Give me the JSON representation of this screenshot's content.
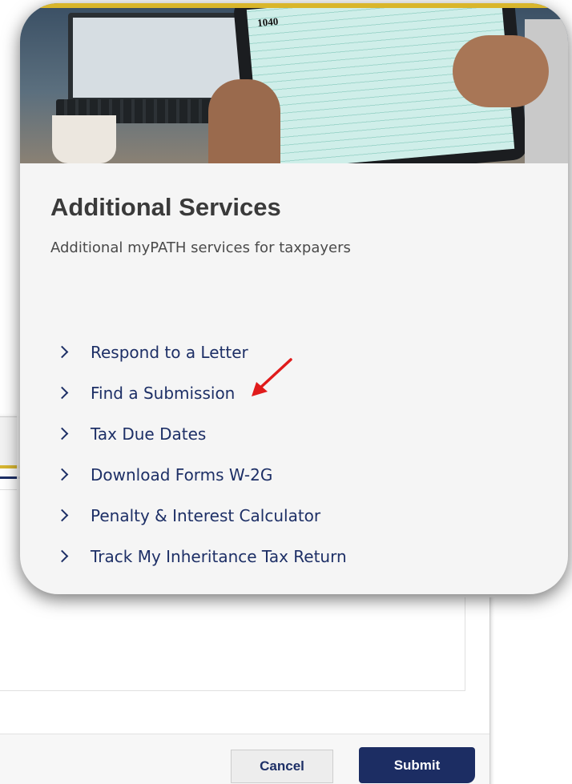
{
  "card": {
    "title": "Additional Services",
    "subtitle": "Additional myPATH services for taxpayers",
    "links": [
      {
        "label": "Respond to a Letter",
        "icon": "chevron-right-icon"
      },
      {
        "label": "Find a Submission",
        "icon": "chevron-right-icon"
      },
      {
        "label": "Tax Due Dates",
        "icon": "chevron-right-icon"
      },
      {
        "label": "Download Forms W-2G",
        "icon": "chevron-right-icon"
      },
      {
        "label": "Penalty & Interest Calculator",
        "icon": "chevron-right-icon"
      },
      {
        "label": "Track My Inheritance Tax Return",
        "icon": "chevron-right-icon"
      }
    ],
    "hero_image": {
      "form_label": "1040"
    }
  },
  "dialog": {
    "cancel_label": "Cancel",
    "submit_label": "Submit"
  },
  "annotation": {
    "arrow_color": "#e01b1b"
  },
  "colors": {
    "link": "#1d2f66",
    "accent_gold": "#d9b62b",
    "submit_bg": "#1c2d63"
  }
}
